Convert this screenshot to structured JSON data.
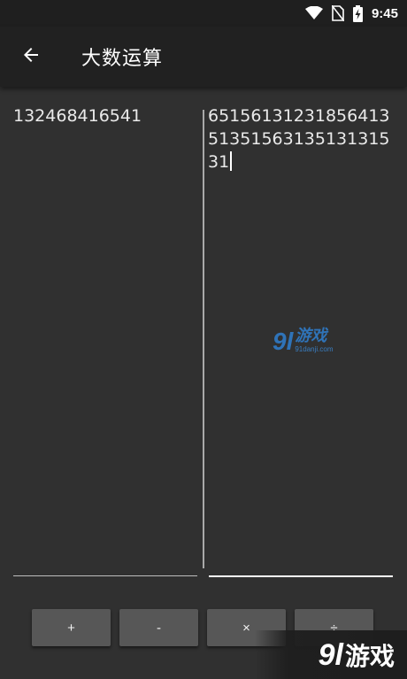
{
  "status_bar": {
    "time": "9:45",
    "icons": [
      "wifi-icon",
      "no-sim-icon",
      "battery-charging-icon"
    ]
  },
  "app_bar": {
    "back_icon": "arrow-left-icon",
    "title": "大数运算"
  },
  "operands": {
    "left_value": "132468416541",
    "right_value": "651561312318564135135156313513131531"
  },
  "operations": [
    {
      "label": "+"
    },
    {
      "label": "-"
    },
    {
      "label": "×"
    },
    {
      "label": "÷"
    }
  ],
  "watermarks": {
    "center_number": "9l",
    "center_text": "游戏",
    "center_domain": "91danji.com",
    "corner_number": "9l",
    "corner_text": "游戏"
  },
  "colors": {
    "background": "#303030",
    "app_bar": "#212121",
    "button": "#575757",
    "watermark_blue": "#2f7fd0"
  }
}
